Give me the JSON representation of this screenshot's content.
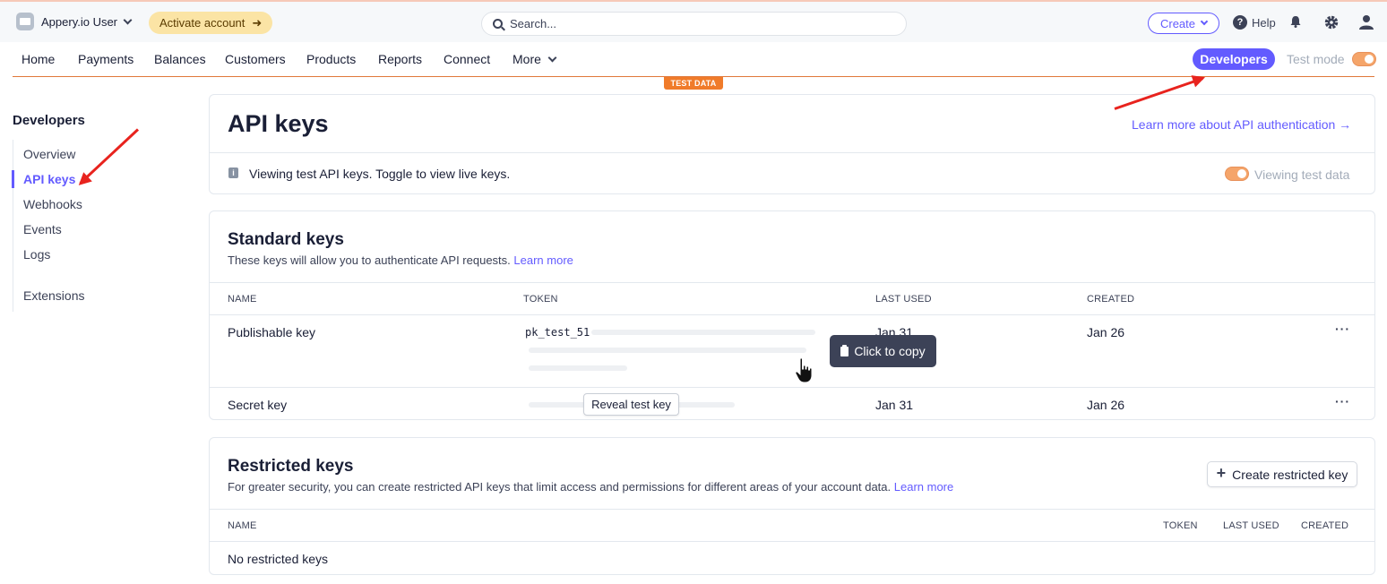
{
  "topbar": {
    "account_name": "Appery.io User",
    "activate_label": "Activate account",
    "search_placeholder": "Search...",
    "create_label": "Create",
    "help_label": "Help"
  },
  "nav": {
    "items": [
      "Home",
      "Payments",
      "Balances",
      "Customers",
      "Products",
      "Reports",
      "Connect",
      "More"
    ],
    "developers_label": "Developers",
    "test_mode_label": "Test mode",
    "test_data_badge": "TEST DATA"
  },
  "sidebar": {
    "title": "Developers",
    "items": [
      "Overview",
      "API keys",
      "Webhooks",
      "Events",
      "Logs",
      "Extensions"
    ],
    "active": "API keys"
  },
  "api_keys": {
    "title": "API keys",
    "learn_more_auth": "Learn more about API authentication →",
    "info_text": "Viewing test API keys. Toggle to view live keys.",
    "viewing_test_data": "Viewing test data"
  },
  "standard_keys": {
    "title": "Standard keys",
    "description": "These keys will allow you to authenticate API requests.",
    "learn_more": "Learn more",
    "columns": [
      "NAME",
      "TOKEN",
      "LAST USED",
      "CREATED"
    ],
    "rows": [
      {
        "name": "Publishable key",
        "token": "pk_test_51",
        "last_used": "Jan 31",
        "created": "Jan 26"
      },
      {
        "name": "Secret key",
        "token": "",
        "last_used": "Jan 31",
        "created": "Jan 26"
      }
    ],
    "copy_tooltip": "Click to copy",
    "reveal_label": "Reveal test key"
  },
  "restricted_keys": {
    "title": "Restricted keys",
    "description": "For greater security, you can create restricted API keys that limit access and permissions for different areas of your account data.",
    "learn_more": "Learn more",
    "create_label": "Create restricted key",
    "columns": [
      "NAME",
      "TOKEN",
      "LAST USED",
      "CREATED"
    ],
    "empty_text": "No restricted keys"
  },
  "colors": {
    "accent": "#635bff",
    "test_orange": "#f07b2a",
    "annotation_red": "#e8231e"
  }
}
